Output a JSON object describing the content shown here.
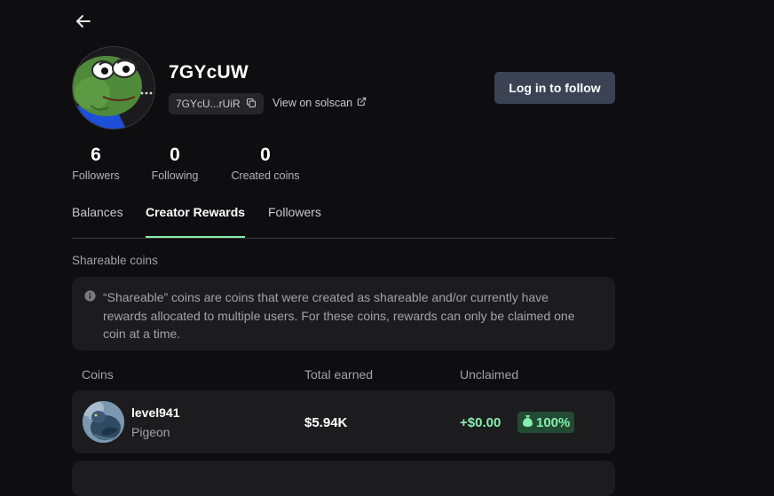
{
  "profile": {
    "username": "7GYcUW",
    "address_short": "7GYcU...rUiR",
    "solscan_label": "View on solscan",
    "follow_button": "Log in to follow"
  },
  "stats": [
    {
      "value": "6",
      "label": "Followers"
    },
    {
      "value": "0",
      "label": "Following"
    },
    {
      "value": "0",
      "label": "Created coins"
    }
  ],
  "tabs": [
    {
      "label": "Balances",
      "active": false
    },
    {
      "label": "Creator Rewards",
      "active": true
    },
    {
      "label": "Followers",
      "active": false
    }
  ],
  "section": {
    "title": "Shareable coins",
    "info_text": "“Shareable” coins are coins that were created as shareable and/or currently have rewards allocated to multiple users. For these coins, rewards can only be claimed one coin at a time."
  },
  "table": {
    "headers": [
      "Coins",
      "Total earned",
      "Unclaimed"
    ],
    "rows": [
      {
        "name": "level941",
        "ticker": "Pigeon",
        "total_earned": "$5.94K",
        "unclaimed": "+$0.00",
        "share": "100%"
      }
    ]
  },
  "colors": {
    "accent_green": "#86efac",
    "button_bg": "#3b4253",
    "background": "#0e0e10",
    "card": "#1c1c1f"
  },
  "icons": [
    "back-arrow-icon",
    "copy-icon",
    "external-link-icon",
    "info-icon",
    "money-bag-icon"
  ]
}
